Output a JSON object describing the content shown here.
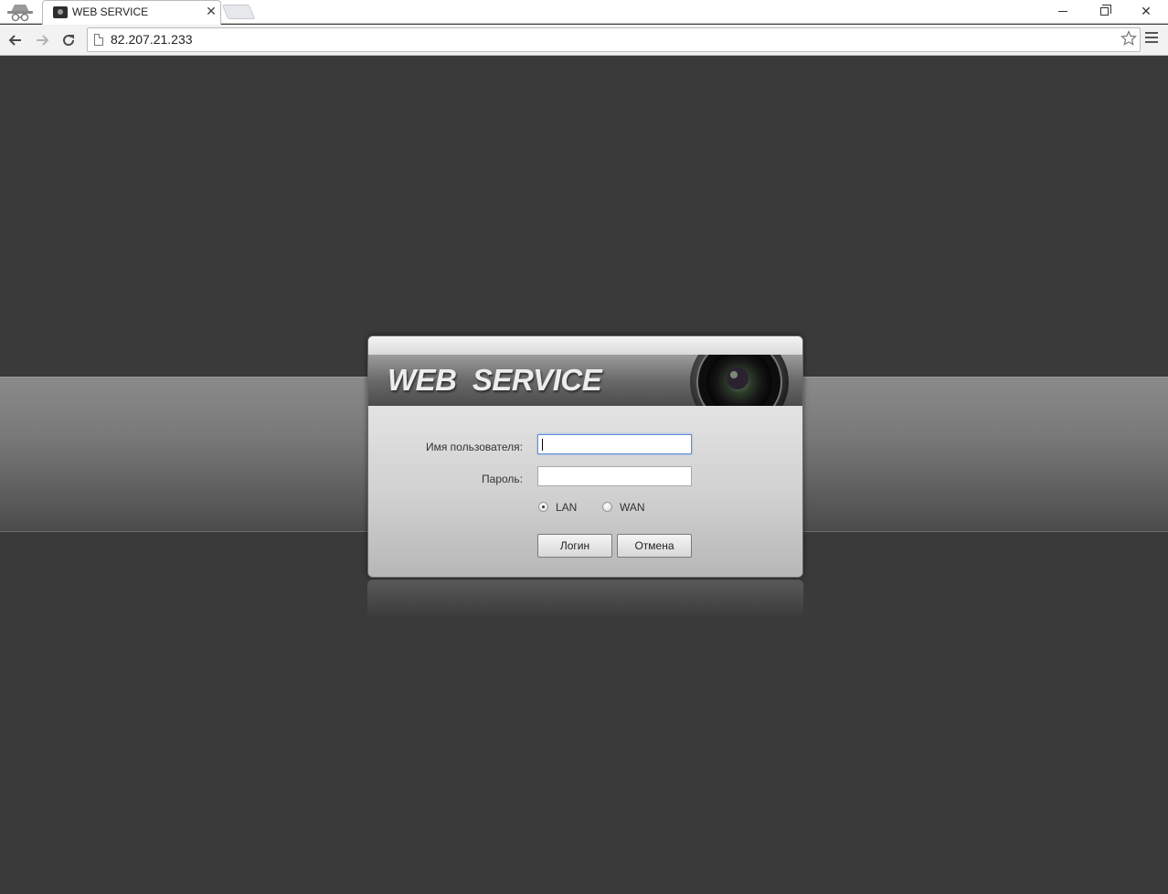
{
  "browser": {
    "tab": {
      "title": "WEB SERVICE",
      "close_glyph": "✕",
      "favicon": "camera-icon"
    },
    "address_bar": {
      "url": "82.207.21.233"
    },
    "icons": {
      "back": "back-arrow-icon",
      "forward": "forward-arrow-icon",
      "reload": "reload-icon",
      "bookmark": "star-icon",
      "menu": "hamburger-menu-icon",
      "incognito": "incognito-icon"
    },
    "window_controls": {
      "minimize": "minimize-icon",
      "maximize": "restore-icon",
      "close_glyph": "✕"
    }
  },
  "login": {
    "banner_title": "WEB  SERVICE",
    "username_label": "Имя пользователя:",
    "username_value": "",
    "password_label": "Пароль:",
    "password_value": "",
    "network_options": [
      {
        "label": "LAN",
        "selected": true
      },
      {
        "label": "WAN",
        "selected": false
      }
    ],
    "login_button": "Логин",
    "cancel_button": "Отмена"
  },
  "colors": {
    "page_background": "#3a3a3a",
    "band": "#787878",
    "focus_border": "#5b8fd6"
  }
}
